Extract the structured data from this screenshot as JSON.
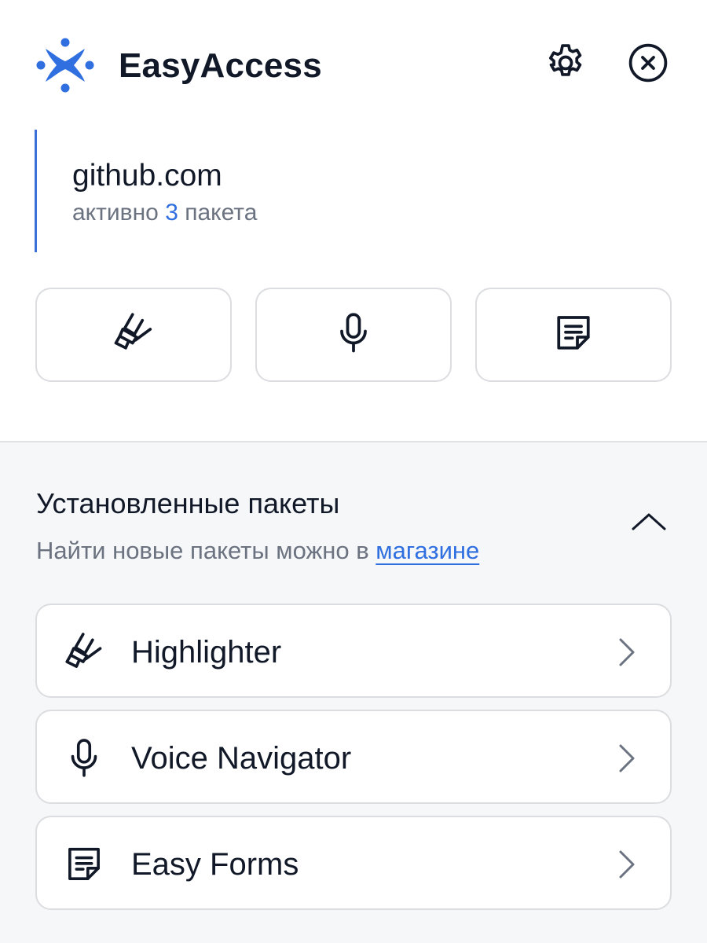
{
  "header": {
    "app_name": "EasyAccess",
    "logo_icon": "easyaccess-logo",
    "brand_color": "#2f6fe0",
    "settings_icon": "gear-icon",
    "close_icon": "close-circle-icon"
  },
  "site": {
    "domain": "github.com",
    "status_prefix": "активно",
    "active_count": "3",
    "status_suffix": "пакета",
    "accent_color": "#3b6fd8"
  },
  "quick_actions": [
    {
      "icon": "highlighter-icon"
    },
    {
      "icon": "microphone-icon"
    },
    {
      "icon": "form-note-icon"
    }
  ],
  "installed": {
    "title": "Установленные пакеты",
    "subtitle_prefix": "Найти новые пакеты можно в",
    "store_link": "магазине",
    "collapse_icon": "chevron-up-icon",
    "packages": [
      {
        "label": "Highlighter",
        "icon": "highlighter-icon"
      },
      {
        "label": "Voice Navigator",
        "icon": "microphone-icon"
      },
      {
        "label": "Easy Forms",
        "icon": "form-note-icon"
      }
    ]
  }
}
